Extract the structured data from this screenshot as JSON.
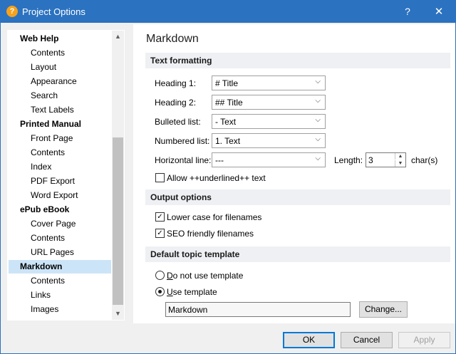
{
  "window": {
    "title": "Project Options",
    "help": "?",
    "close": "✕",
    "icon_text": "?"
  },
  "tree": {
    "items": [
      {
        "label": "Web Help",
        "level": "root"
      },
      {
        "label": "Contents",
        "level": "child"
      },
      {
        "label": "Layout",
        "level": "child"
      },
      {
        "label": "Appearance",
        "level": "child"
      },
      {
        "label": "Search",
        "level": "child"
      },
      {
        "label": "Text Labels",
        "level": "child"
      },
      {
        "label": "Printed Manual",
        "level": "root"
      },
      {
        "label": "Front Page",
        "level": "child"
      },
      {
        "label": "Contents",
        "level": "child"
      },
      {
        "label": "Index",
        "level": "child"
      },
      {
        "label": "PDF Export",
        "level": "child"
      },
      {
        "label": "Word Export",
        "level": "child"
      },
      {
        "label": "ePub eBook",
        "level": "root"
      },
      {
        "label": "Cover Page",
        "level": "child"
      },
      {
        "label": "Contents",
        "level": "child"
      },
      {
        "label": "URL Pages",
        "level": "child"
      },
      {
        "label": "Markdown",
        "level": "root",
        "selected": true
      },
      {
        "label": "Contents",
        "level": "child"
      },
      {
        "label": "Links",
        "level": "child"
      },
      {
        "label": "Images",
        "level": "child"
      }
    ]
  },
  "page": {
    "title": "Markdown"
  },
  "text_formatting": {
    "header": "Text formatting",
    "heading1": {
      "label": "Heading 1:",
      "value": "# Title"
    },
    "heading2": {
      "label": "Heading 2:",
      "value": "## Title"
    },
    "bulleted": {
      "label": "Bulleted list:",
      "value": "- Text"
    },
    "numbered": {
      "label": "Numbered list:",
      "value": "1. Text"
    },
    "hline": {
      "label": "Horizontal line:",
      "value": "---"
    },
    "length": {
      "label": "Length:",
      "value": "3",
      "unit": "char(s)"
    },
    "underline": {
      "label": "Allow ++underlined++ text",
      "checked": false
    }
  },
  "output_options": {
    "header": "Output options",
    "lowercase": {
      "label": "Lower case for filenames",
      "checked": true
    },
    "seo": {
      "label": "SEO friendly filenames",
      "checked": true
    }
  },
  "template": {
    "header": "Default topic template",
    "no_template": {
      "label_first": "D",
      "label_rest": "o not use template",
      "selected": false
    },
    "use_template": {
      "label_first": "U",
      "label_rest": "se template",
      "selected": true
    },
    "value": "Markdown",
    "change_first": "Chan",
    "change_u": "g",
    "change_rest": "e..."
  },
  "footer": {
    "ok": "OK",
    "cancel": "Cancel",
    "apply": "Apply"
  }
}
